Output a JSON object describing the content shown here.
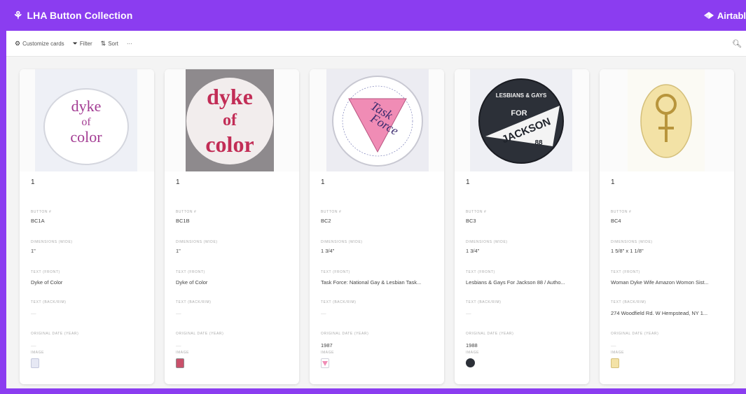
{
  "app": {
    "title": "LHA Button Collection",
    "brand": "Airtabl",
    "accent_color": "#8b3df0",
    "logo_icon": "puzzle-icon"
  },
  "toolbar": {
    "customize_label": "Customize cards",
    "filter_label": "Filter",
    "sort_label": "Sort",
    "more_label": "···"
  },
  "labels": {
    "button_no": "BUTTON #",
    "dimensions": "DIMENSIONS (WIDE)",
    "text_front": "TEXT (FRONT)",
    "text_back": "TEXT (BACK/RIM)",
    "original_date": "ORIGINAL DATE (YEAR)",
    "image": "IMAGE"
  },
  "cards": [
    {
      "primary": "1",
      "button_no": "BC1A",
      "dimensions": "1\"",
      "text_front": "Dyke of Color",
      "text_back": "—",
      "original_date": "—",
      "image_text": [
        "dyke",
        "of",
        "color"
      ]
    },
    {
      "primary": "1",
      "button_no": "BC1B",
      "dimensions": "1\"",
      "text_front": "Dyke of Color",
      "text_back": "—",
      "original_date": "—",
      "image_text": [
        "dyke",
        "of",
        "color"
      ]
    },
    {
      "primary": "1",
      "button_no": "BC2",
      "dimensions": "1 3/4\"",
      "text_front": "Task Force: National Gay & Lesbian Task...",
      "text_back": "—",
      "original_date": "1987",
      "image_text": [
        "Task",
        "Force"
      ]
    },
    {
      "primary": "1",
      "button_no": "BC3",
      "dimensions": "1 3/4\"",
      "text_front": "Lesbians & Gays For Jackson 88 / Autho...",
      "text_back": "—",
      "original_date": "1988",
      "image_text": [
        "LESBIANS & GAYS",
        "FOR",
        "JACKSON",
        "88"
      ]
    },
    {
      "primary": "1",
      "button_no": "BC4",
      "dimensions": "1 5/8\" x 1 1/8\"",
      "text_front": "Woman Dyke Wife Amazon Womon Sist...",
      "text_back": "274 Woodfield Rd. W Hempstead, NY 1...",
      "original_date": "—",
      "image_text": []
    }
  ]
}
